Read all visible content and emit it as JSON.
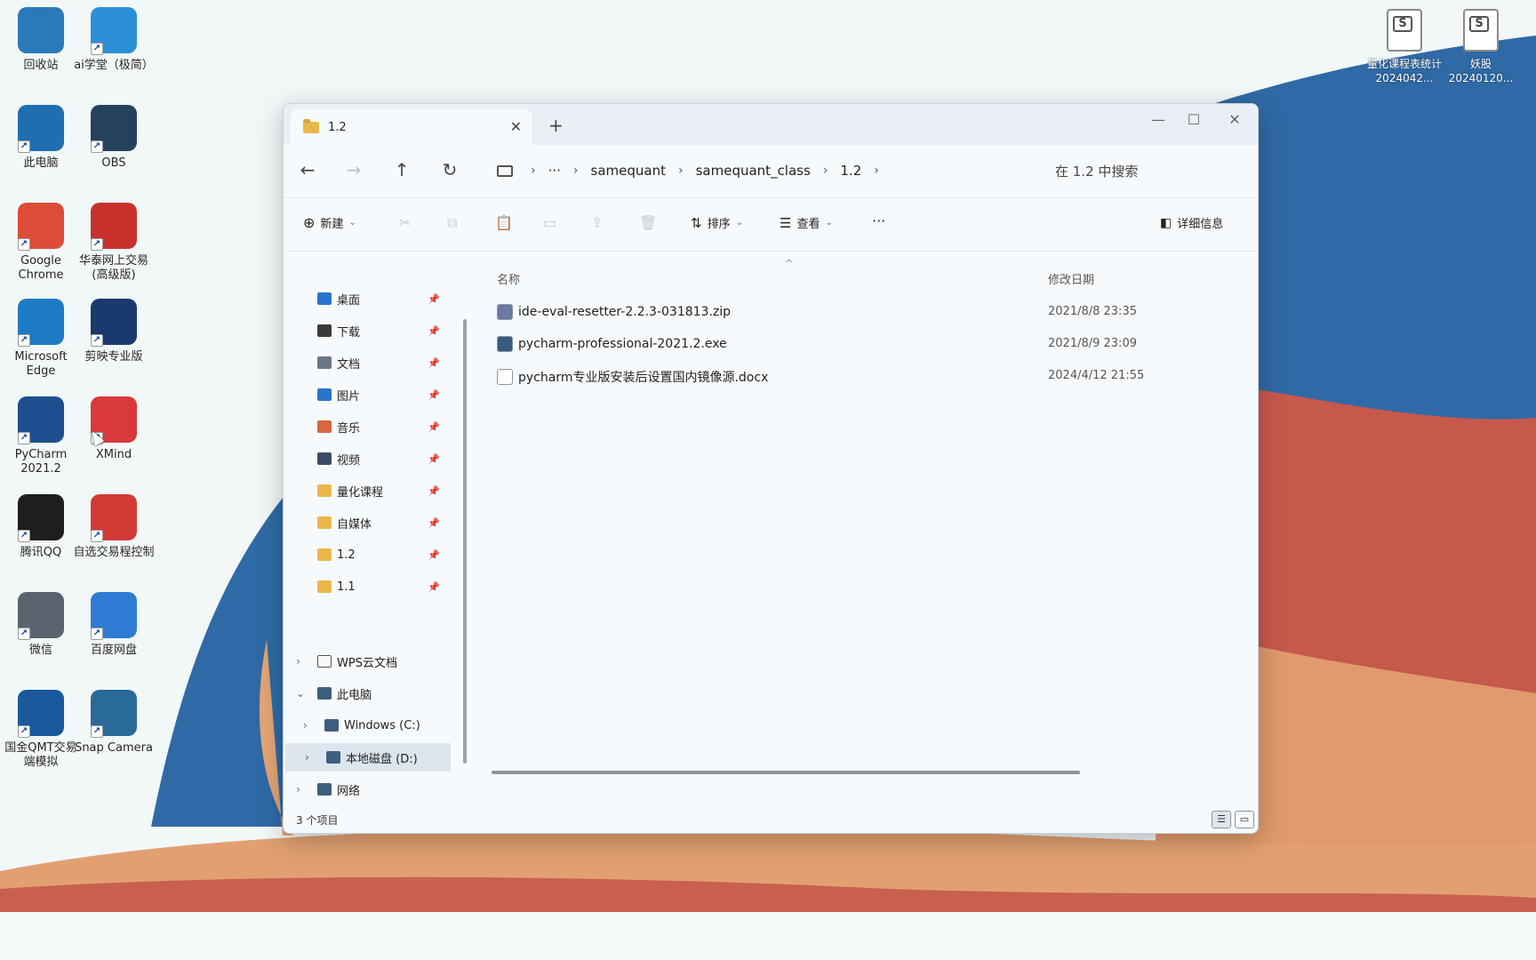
{
  "desktop": {
    "icons_left": [
      {
        "label": "回收站",
        "icon": "recycle-bin-icon",
        "color": "#2a7ab8"
      },
      {
        "label": "ai学堂（极简）",
        "icon": "ie-icon",
        "color": "#2b8fd6"
      },
      {
        "label": "此电脑",
        "icon": "monitor-icon",
        "color": "#1f6fb0"
      },
      {
        "label": "OBS",
        "icon": "obs-icon",
        "color": "#24415e"
      },
      {
        "label": "Google Chrome",
        "icon": "chrome-icon",
        "color": "#dd4b39"
      },
      {
        "label": "华泰网上交易(高级版)",
        "icon": "trading-icon",
        "color": "#c8322d"
      },
      {
        "label": "Microsoft Edge",
        "icon": "edge-icon",
        "color": "#1d7bc4"
      },
      {
        "label": "剪映专业版",
        "icon": "capcut-icon",
        "color": "#1a3a6d"
      },
      {
        "label": "PyCharm 2021.2",
        "icon": "pycharm-icon",
        "color": "#1d4f8f"
      },
      {
        "label": "XMind",
        "icon": "xmind-icon",
        "color": "#d9393a"
      },
      {
        "label": "腾讯QQ",
        "icon": "qq-icon",
        "color": "#1e1e1e"
      },
      {
        "label": "自选交易程控制",
        "icon": "play-icon",
        "color": "#d23a36"
      },
      {
        "label": "微信",
        "icon": "wechat-icon",
        "color": "#5a6470"
      },
      {
        "label": "百度网盘",
        "icon": "baidu-netdisk-icon",
        "color": "#2f7bd4"
      },
      {
        "label": "国金QMT交易端模拟",
        "icon": "qmt-icon",
        "color": "#1a5a9c"
      },
      {
        "label": "Snap Camera",
        "icon": "snap-camera-icon",
        "color": "#2a6a99"
      }
    ],
    "icons_right": [
      {
        "label": "量化课程表统计2024042...",
        "icon": "wps-doc-icon"
      },
      {
        "label": "妖股20240120...",
        "icon": "wps-doc-icon"
      }
    ],
    "wallpaper_colors": {
      "sky": "#f2f7f8",
      "blue": "#2e6aa6",
      "sand": "#e3a574",
      "red": "#c6584c"
    }
  },
  "explorer": {
    "tab_title": "1.2",
    "tab_close": "✕",
    "new_tab": "+",
    "window_controls": {
      "minimize": "—",
      "maximize": "☐",
      "close": "✕"
    },
    "nav": {
      "back": "←",
      "forward": "→",
      "up": "↑",
      "refresh": "↻"
    },
    "breadcrumb": [
      "samequant",
      "samequant_class",
      "1.2"
    ],
    "breadcrumb_more": "···",
    "search_placeholder": "在 1.2 中搜索",
    "toolbar": {
      "new_label": "新建",
      "sort_label": "排序",
      "view_label": "查看",
      "more": "···",
      "details_label": "详细信息"
    },
    "sidebar": {
      "quick": [
        {
          "label": "桌面",
          "icon": "desktop-icon",
          "color": "#2a73c9"
        },
        {
          "label": "下载",
          "icon": "download-icon",
          "color": "#3b3b3b"
        },
        {
          "label": "文档",
          "icon": "documents-icon",
          "color": "#6b7785"
        },
        {
          "label": "图片",
          "icon": "pictures-icon",
          "color": "#2a73c9"
        },
        {
          "label": "音乐",
          "icon": "music-icon",
          "color": "#d8663e"
        },
        {
          "label": "视频",
          "icon": "videos-icon",
          "color": "#3a4c66"
        },
        {
          "label": "量化课程",
          "icon": "folder-icon",
          "color": "#e8b84c"
        },
        {
          "label": "自媒体",
          "icon": "folder-icon",
          "color": "#e8b84c"
        },
        {
          "label": "1.2",
          "icon": "folder-icon",
          "color": "#e8b84c"
        },
        {
          "label": "1.1",
          "icon": "folder-icon",
          "color": "#e8b84c"
        }
      ],
      "pin": "📌",
      "tree": [
        {
          "label": "WPS云文档",
          "icon": "cloud-icon",
          "expander": "›"
        },
        {
          "label": "此电脑",
          "icon": "this-pc-icon",
          "expander": "⌄"
        },
        {
          "label": "Windows (C:)",
          "icon": "drive-c-icon",
          "expander": "›"
        },
        {
          "label": "本地磁盘 (D:)",
          "icon": "drive-d-icon",
          "expander": "›"
        },
        {
          "label": "网络",
          "icon": "network-icon",
          "expander": "›"
        }
      ]
    },
    "columns": {
      "name": "名称",
      "modified": "修改日期"
    },
    "files": [
      {
        "name": "ide-eval-resetter-2.2.3-031813.zip",
        "modified": "2021/8/8 23:35",
        "icon": "zip-icon",
        "color": "#6b78a0"
      },
      {
        "name": "pycharm-professional-2021.2.exe",
        "modified": "2021/8/9 23:09",
        "icon": "exe-icon",
        "color": "#3a5a7a"
      },
      {
        "name": "pycharm专业版安装后设置国内镜像源.docx",
        "modified": "2024/4/12 21:55",
        "icon": "docx-icon",
        "color": "#ffffff"
      }
    ],
    "status": {
      "count": "3 个项目",
      "view_details": "☰",
      "view_tiles": "▭"
    }
  }
}
